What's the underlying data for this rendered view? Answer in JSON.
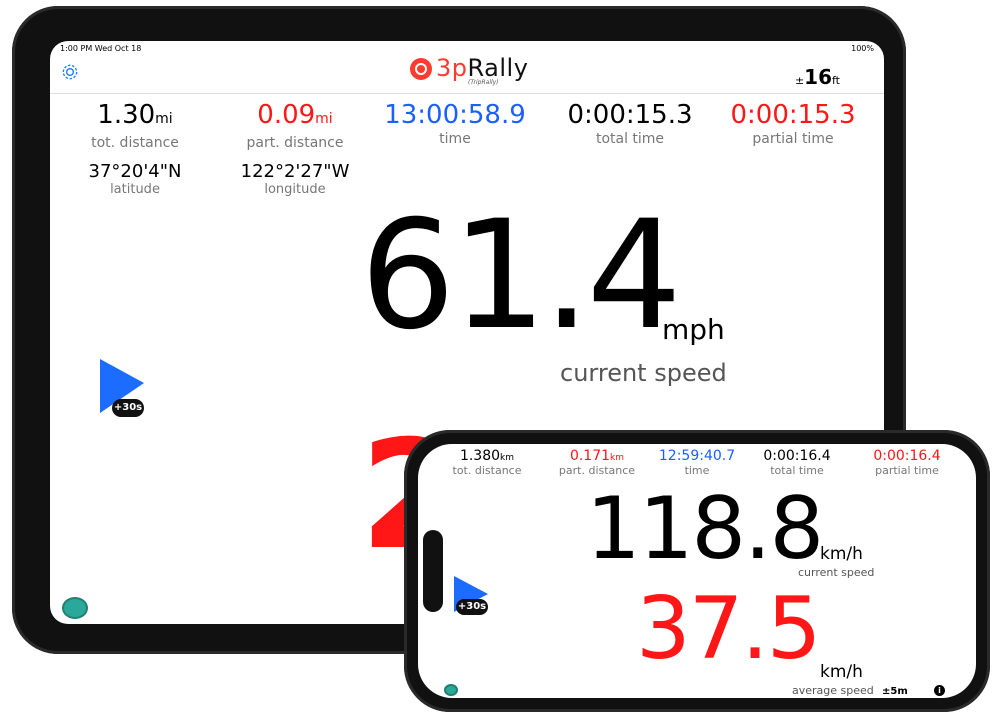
{
  "tablet": {
    "status_left": "1:00 PM   Wed Oct 18",
    "status_right": "100%",
    "app_name_prefix": "3p",
    "app_name_suffix": "Rally",
    "app_sub": "(TripRally)",
    "altitude_prefix": "±",
    "altitude_value": "16",
    "altitude_unit": "ft",
    "stats": [
      {
        "value": "1.30",
        "unit": "mi",
        "label": "tot. distance"
      },
      {
        "value": "0.09",
        "unit": "mi",
        "label": "part. distance"
      },
      {
        "value": "13:00:58.9",
        "unit": "",
        "label": "time"
      },
      {
        "value": "0:00:15.3",
        "unit": "",
        "label": "total time"
      },
      {
        "value": "0:00:15.3",
        "unit": "",
        "label": "partial time"
      }
    ],
    "coords": [
      {
        "value": "37°20'4\"N",
        "label": "latitude"
      },
      {
        "value": "122°2'27\"W",
        "label": "longitude"
      }
    ],
    "speed_value": "61.4",
    "speed_unit": "mph",
    "speed_label": "current speed",
    "partial_value": "20.",
    "play_badge": "+30s"
  },
  "phone": {
    "stats": [
      {
        "value": "1.380",
        "unit": "km",
        "label": "tot. distance"
      },
      {
        "value": "0.171",
        "unit": "km",
        "label": "part. distance"
      },
      {
        "value": "12:59:40.7",
        "unit": "",
        "label": "time"
      },
      {
        "value": "0:00:16.4",
        "unit": "",
        "label": "total time"
      },
      {
        "value": "0:00:16.4",
        "unit": "",
        "label": "partial time"
      }
    ],
    "speed_value": "118.8",
    "speed_unit": "km/h",
    "speed_label": "current speed",
    "avg_value": "37.5",
    "avg_unit": "km/h",
    "avg_label": "average speed",
    "accuracy": "±5m",
    "info": "i",
    "play_badge": "+30s"
  },
  "colors": {
    "accent_red": "#ff1616",
    "accent_blue": "#1a5fff",
    "play_blue": "#1b6cff",
    "camera_teal": "#2aa99b"
  }
}
